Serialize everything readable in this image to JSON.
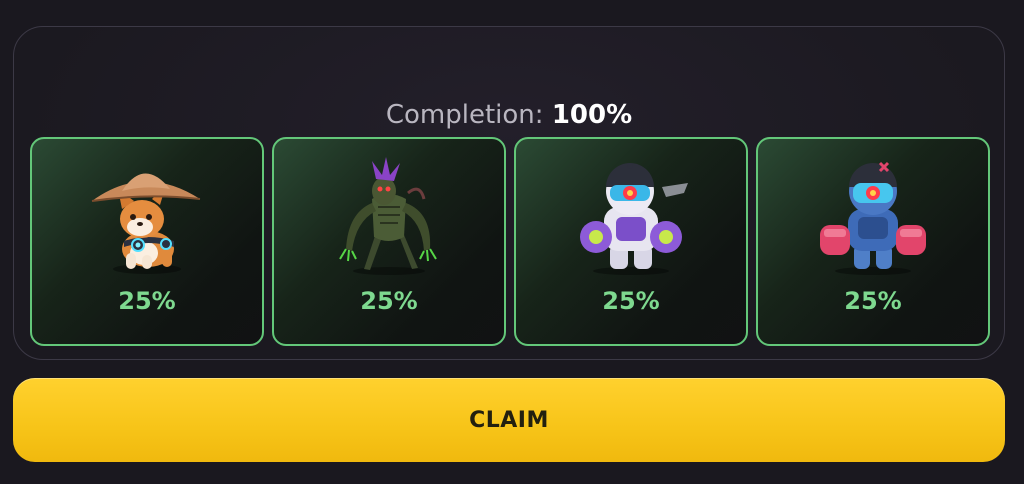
{
  "completion": {
    "label": "Completion:",
    "value": "100%"
  },
  "cards": [
    {
      "character": "shiba-dog-straw-hat",
      "percent": "25%"
    },
    {
      "character": "green-alien-creature",
      "percent": "25%"
    },
    {
      "character": "purple-robot-astronaut",
      "percent": "25%"
    },
    {
      "character": "blue-red-robot-astronaut",
      "percent": "25%"
    }
  ],
  "claim_button": {
    "label": "CLAIM"
  },
  "colors": {
    "accent_green": "#7ed98f",
    "card_border": "#63c779",
    "claim_yellow": "#f7c418"
  }
}
